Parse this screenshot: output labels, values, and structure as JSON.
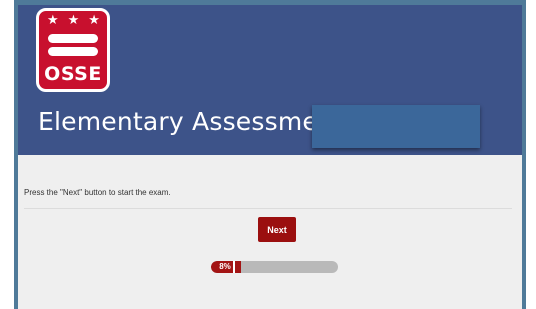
{
  "header": {
    "logo_text": "OSSE",
    "title": "Elementary Assessment"
  },
  "main": {
    "instruction": "Press the \"Next\" button to start the exam.",
    "next_label": "Next",
    "progress": {
      "value_percent": 8,
      "label": "8%"
    }
  },
  "colors": {
    "banner": "#3d5389",
    "accent": "#9b0f0f",
    "logo": "#c8102e",
    "page_background": "#efefef"
  }
}
